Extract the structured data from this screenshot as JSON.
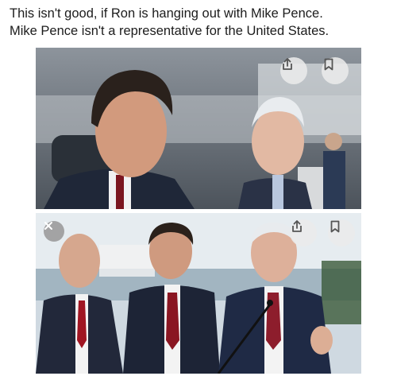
{
  "post": {
    "caption_line1": "This isn't good, if Ron is hanging out with Mike Pence.",
    "caption_line2": "Mike Pence isn't a representative for the United States."
  },
  "images": [
    {
      "buttons": [
        "share-icon",
        "bookmark-icon"
      ]
    },
    {
      "buttons": [
        "close-icon",
        "share-icon",
        "bookmark-icon"
      ]
    }
  ],
  "colors": {
    "text": "#1c1c1c",
    "button_bg": "#ebebeb",
    "button_icon": "#555555"
  }
}
